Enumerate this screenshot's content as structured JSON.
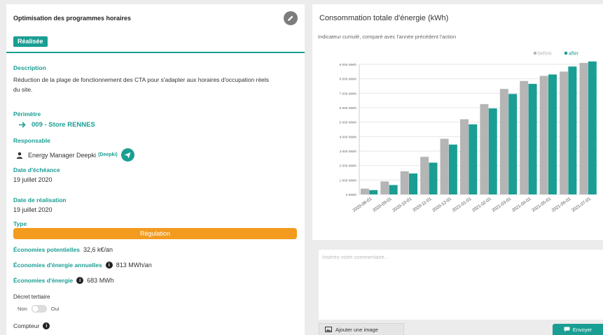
{
  "action": {
    "title": "Optimisation des programmes horaires",
    "status": "Réalisée",
    "description_label": "Description",
    "description": "Réduction de la plage de fonctionnement des CTA pour s'adapter aux horaires d'occupation réels du site.",
    "perimetre_label": "Périmètre",
    "perimetre_value": "009 - Store RENNES",
    "responsable_label": "Responsable",
    "responsable_name": "Energy Manager Deepki",
    "responsable_org": "(Deepki)",
    "echeance_label": "Date d'échéance",
    "echeance_value": "19 juillet 2020",
    "realisation_label": "Date de réalisation",
    "realisation_value": "19 juillet 2020",
    "type_label": "Type",
    "type_value": "Régulation",
    "eco_pot_label": "Économies potentielles",
    "eco_pot_value": "32,6 k€/an",
    "eco_energie_annuelles_label": "Économies d'énergie annuelles",
    "eco_energie_annuelles_value": "813 MWh/an",
    "eco_energie_label": "Économies d'énergie",
    "eco_energie_value": "683 MWh",
    "decret_label": "Décret tertiaire",
    "decret_non": "Non",
    "decret_oui": "Oui",
    "compteur_label": "Compteur"
  },
  "icons": {
    "edit": "pencil-icon",
    "arrow": "arrow-right-icon",
    "user": "user-icon",
    "send": "paper-plane-icon",
    "info": "info-icon",
    "image": "image-icon",
    "chat": "chat-bubble-icon"
  },
  "colors": {
    "teal": "#1a9e93",
    "orange": "#f39b1e",
    "before_bar": "#b5b5b5",
    "after_bar": "#1a9e93"
  },
  "chart_panel": {
    "title": "Consommation totale d'énergie (kWh)",
    "subtitle": "Indicateur cumulé, comparé avec l'année précédent l'action"
  },
  "chart_data": {
    "type": "bar",
    "categories": [
      "2020-08-01",
      "2020-09-01",
      "2020-10-01",
      "2020-11-01",
      "2020-12-01",
      "2021-01-01",
      "2021-02-01",
      "2021-03-01",
      "2021-04-01",
      "2021-05-01",
      "2021-06-01",
      "2021-07-01"
    ],
    "series": [
      {
        "name": "before",
        "values": [
          400,
          900,
          1600,
          2600,
          3850,
          5200,
          6250,
          7300,
          7850,
          8200,
          8500,
          9100
        ]
      },
      {
        "name": "after",
        "values": [
          300,
          650,
          1450,
          2200,
          3450,
          4850,
          5950,
          6950,
          7650,
          8300,
          8850,
          9200
        ]
      }
    ],
    "y_ticks": [
      "0 MWh",
      "1 000 MWh",
      "2 000 MWh",
      "3 000 MWh",
      "4 000 MWh",
      "5 000 MWh",
      "6 000 MWh",
      "7 000 MWh",
      "8 000 MWh",
      "9 000 MWh"
    ],
    "ylim": [
      0,
      9000
    ],
    "grid": true,
    "legend_position": "top-right"
  },
  "comment": {
    "placeholder": "Insérez votre commentaire...",
    "add_image_label": "Ajouter une image",
    "send_label": "Envoyer"
  }
}
